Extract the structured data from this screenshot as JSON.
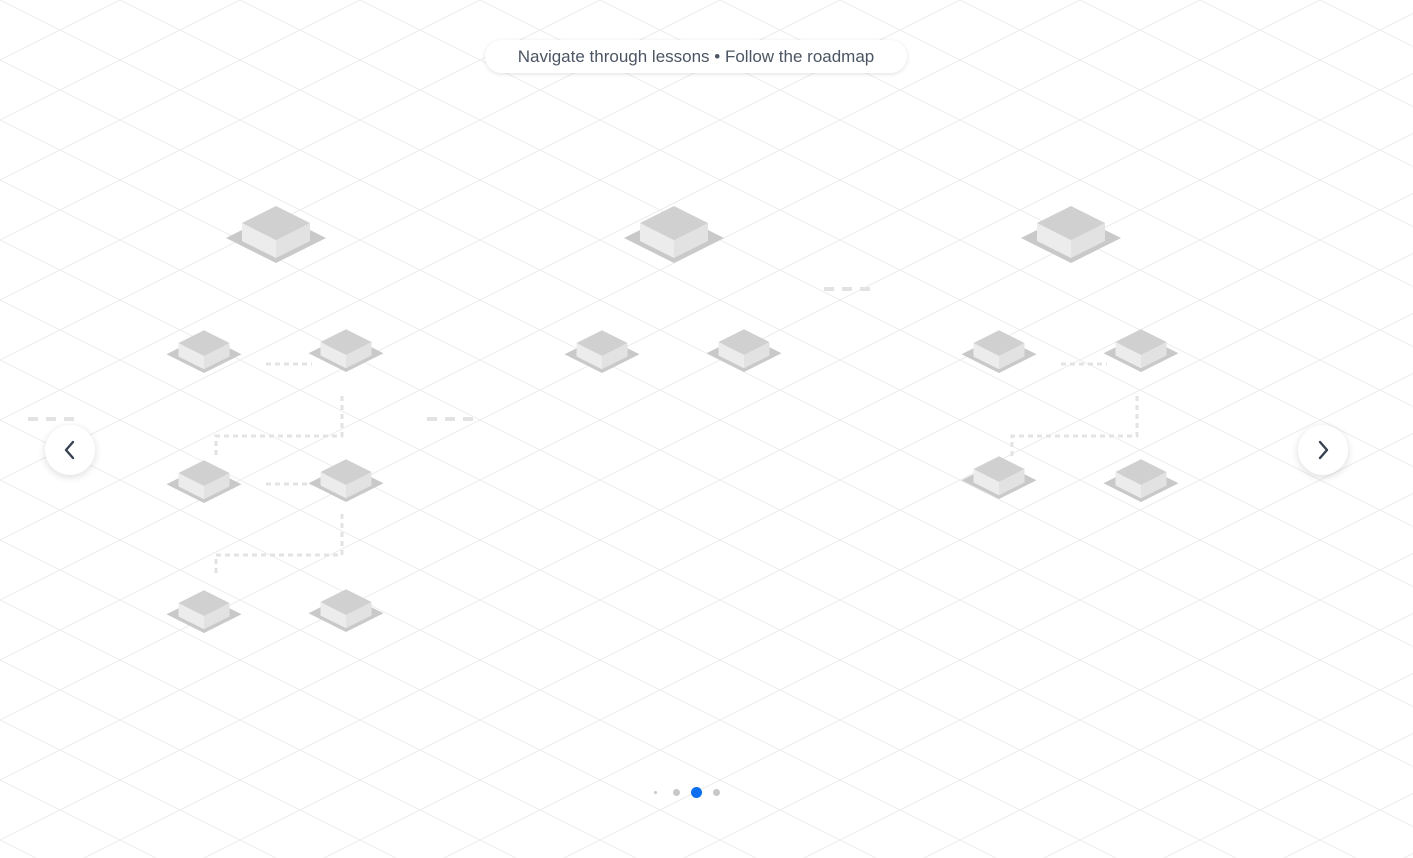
{
  "hint": {
    "text": "Navigate through lessons • Follow the roadmap"
  },
  "navigation": {
    "prev_icon": "chevron-left-icon",
    "next_icon": "chevron-right-icon"
  },
  "pagination": {
    "total": 4,
    "active_index": 2
  },
  "colors": {
    "background": "#ffffff",
    "grid_line": "#ececec",
    "block_top": "#d0d0d0",
    "block_side": "#ececec",
    "block_base": "#c9c9c9",
    "connector": "#e3e3e3",
    "dot_active": "#0b6ff0",
    "dot_inactive": "#c8c8c8",
    "hint_text": "#4b5563",
    "chevron": "#374151"
  },
  "roadmap": {
    "stage_count": 3,
    "stage_lessons": [
      7,
      3,
      5
    ]
  }
}
